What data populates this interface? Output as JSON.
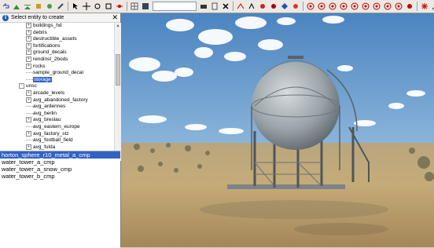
{
  "toolbar": {
    "icons": [
      "undo-icon",
      "redo-icon",
      "terrain-raise-icon",
      "terrain-lower-icon",
      "paint-icon",
      "smooth-icon",
      "brush-icon",
      "select-arrow-icon",
      "move-icon",
      "rotate-icon",
      "scale-icon",
      "snap-icon",
      "grid-icon",
      "save-icon",
      "camera-icon",
      "paste-icon"
    ],
    "search_value": ""
  },
  "panel": {
    "title": "Select entity to create",
    "tree": [
      {
        "label": "buildings_hd",
        "level": 2,
        "expander": "+"
      },
      {
        "label": "debris",
        "level": 2,
        "expander": "+"
      },
      {
        "label": "destructible_assets",
        "level": 2,
        "expander": "+"
      },
      {
        "label": "fortifications",
        "level": 2,
        "expander": "+"
      },
      {
        "label": "ground_decals",
        "level": 2,
        "expander": "+"
      },
      {
        "label": "rendinst_2bods",
        "level": 2,
        "expander": "+"
      },
      {
        "label": "rocks",
        "level": 2,
        "expander": "+"
      },
      {
        "label": "sample_ground_decal",
        "level": 2,
        "expander": ""
      },
      {
        "label": "storage",
        "level": 2,
        "expander": "",
        "selected": true
      },
      {
        "label": "unsc",
        "level": 1,
        "expander": "-"
      },
      {
        "label": "arcade_levels",
        "level": 2,
        "expander": "+"
      },
      {
        "label": "avg_abandoned_factory",
        "level": 2,
        "expander": "+"
      },
      {
        "label": "avg_ardennes",
        "level": 2,
        "expander": ""
      },
      {
        "label": "avg_berlin",
        "level": 2,
        "expander": ""
      },
      {
        "label": "avg_breslau",
        "level": 2,
        "expander": "+"
      },
      {
        "label": "avg_eastern_europe",
        "level": 2,
        "expander": ""
      },
      {
        "label": "avg_factory_stz",
        "level": 2,
        "expander": "+"
      },
      {
        "label": "avg_football_field",
        "level": 2,
        "expander": ""
      },
      {
        "label": "avg_fulda",
        "level": 2,
        "expander": "+"
      },
      {
        "label": "avg_future_city",
        "level": 2,
        "expander": ""
      },
      {
        "label": "avg_japan",
        "level": 2,
        "expander": ""
      }
    ],
    "results": [
      {
        "label": "horton_sphere_r10_metal_a_cmp",
        "selected": true
      },
      {
        "label": "water_tower_a_cmp",
        "selected": false
      },
      {
        "label": "water_tower_a_snow_cmp",
        "selected": false
      },
      {
        "label": "water_tower_b_cmp",
        "selected": false
      }
    ]
  },
  "colors": {
    "selection": "#3163c5",
    "sky_top": "#5e95c9",
    "ground": "#c2a878"
  }
}
